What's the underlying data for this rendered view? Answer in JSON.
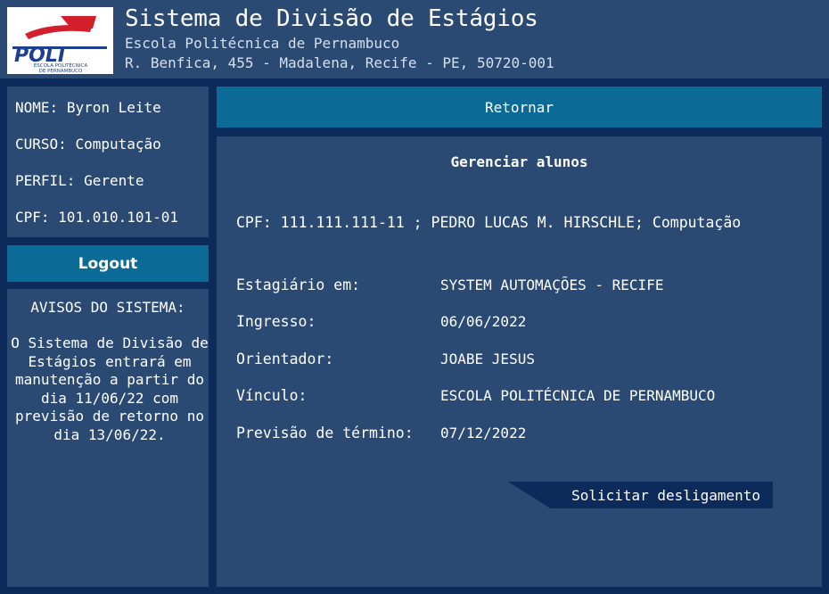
{
  "header": {
    "title": "Sistema de Divisão de Estágios",
    "subtitle": "Escola Politécnica de Pernambuco",
    "address": "R. Benfica, 455 - Madalena, Recife - PE, 50720-001",
    "logo": {
      "brand": "POLI",
      "tagline1": "ESCOLA POLITÉCNICA",
      "tagline2": "DE PERNAMBUCO",
      "colors": {
        "red": "#d21f2b",
        "blue": "#1d3f8f"
      }
    }
  },
  "user": {
    "name_label": "NOME:",
    "name": "Byron Leite",
    "course_label": "CURSO:",
    "course": "Computação",
    "profile_label": "PERFIL:",
    "profile": "Gerente",
    "cpf_label": "CPF:",
    "cpf": "101.010.101-01"
  },
  "logout_label": "Logout",
  "notices": {
    "title": "AVISOS DO SISTEMA:",
    "text": "O Sistema de Divisão de Estágios entrará em manutenção a partir do dia 11/06/22 com previsão de retorno no dia 13/06/22."
  },
  "return_label": "Retornar",
  "main": {
    "title": "Gerenciar alunos",
    "student_line": "CPF: 111.111.111-11 ; PEDRO LUCAS M. HIRSCHLE; Computação",
    "fields": [
      {
        "label": "Estagiário em:",
        "value": "SYSTEM AUTOMAÇÕES - RECIFE"
      },
      {
        "label": "Ingresso:",
        "value": "06/06/2022"
      },
      {
        "label": "Orientador:",
        "value": "JOABE JESUS"
      },
      {
        "label": "Vínculo:",
        "value": "ESCOLA POLITÉCNICA DE PERNAMBUCO"
      },
      {
        "label": "Previsão de término:",
        "value": "07/12/2022"
      }
    ],
    "unlink_label": "Solicitar desligamento"
  },
  "colors": {
    "background": "#0c2a5a",
    "panel": "#2b4a73",
    "accent": "#0b6a96"
  }
}
